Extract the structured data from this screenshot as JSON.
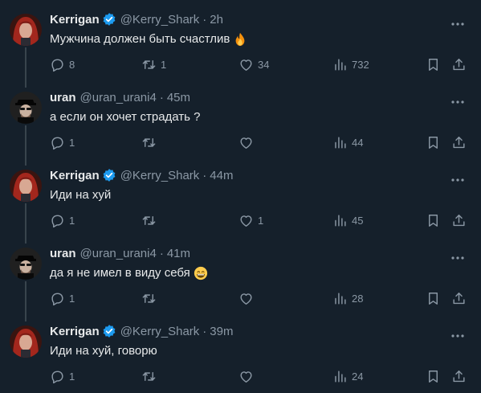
{
  "colors": {
    "background": "#15202b",
    "text_primary": "#e7e9ea",
    "text_secondary": "#8b98a5",
    "verified": "#1d9bf0",
    "thread_line": "#38444d"
  },
  "tweets": [
    {
      "name": "Kerrigan",
      "handle": "@Kerry_Shark",
      "time": "2h",
      "verified": true,
      "avatar": "kerrigan-avatar",
      "text": "Мужчина должен быть счастлив",
      "emoji": "fire-icon",
      "replies": "8",
      "retweets": "1",
      "likes": "34",
      "views": "732"
    },
    {
      "name": "uran",
      "handle": "@uran_urani4",
      "time": "45m",
      "verified": false,
      "avatar": "uran-avatar",
      "text": "а если он хочет страдать ?",
      "replies": "1",
      "retweets": "",
      "likes": "",
      "views": "44"
    },
    {
      "name": "Kerrigan",
      "handle": "@Kerry_Shark",
      "time": "44m",
      "verified": true,
      "avatar": "kerrigan-avatar",
      "text": "Иди на хуй",
      "replies": "1",
      "retweets": "",
      "likes": "1",
      "views": "45"
    },
    {
      "name": "uran",
      "handle": "@uran_urani4",
      "time": "41m",
      "verified": false,
      "avatar": "uran-avatar",
      "text": "да я не имел в виду себя",
      "emoji": "grinning-face-icon",
      "replies": "1",
      "retweets": "",
      "likes": "",
      "views": "28"
    },
    {
      "name": "Kerrigan",
      "handle": "@Kerry_Shark",
      "time": "39m",
      "verified": true,
      "avatar": "kerrigan-avatar",
      "text": "Иди на хуй, говорю",
      "replies": "1",
      "retweets": "",
      "likes": "",
      "views": "24"
    }
  ]
}
